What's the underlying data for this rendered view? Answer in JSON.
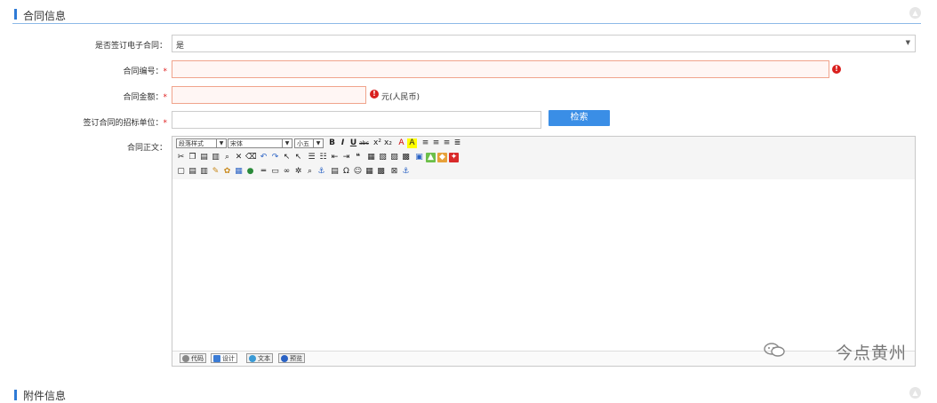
{
  "section": {
    "title": "合同信息"
  },
  "form": {
    "esign": {
      "label": "是否签订电子合同：",
      "value": "是"
    },
    "contract_no": {
      "label": "合同编号：",
      "required": "*"
    },
    "amount": {
      "label": "合同金额：",
      "required": "*",
      "unit": "元(人民币)"
    },
    "bid_unit": {
      "label": "签订合同的招标单位：",
      "required": "*",
      "search_label": "检索"
    },
    "body": {
      "label": "合同正文："
    }
  },
  "editor": {
    "style_select": "段落样式",
    "font_select": "宋体",
    "size_select": "小五",
    "row1_icons": [
      {
        "name": "bold-icon",
        "glyph": "B"
      },
      {
        "name": "italic-icon",
        "glyph": "I"
      },
      {
        "name": "underline-icon",
        "glyph": "U"
      },
      {
        "name": "strikethrough-icon",
        "glyph": "abc"
      },
      {
        "name": "superscript-icon",
        "glyph": "x²"
      },
      {
        "name": "subscript-icon",
        "glyph": "x₂"
      },
      {
        "name": "font-color-icon",
        "glyph": "A"
      },
      {
        "name": "highlight-color-icon",
        "glyph": "A"
      },
      {
        "name": "align-left-icon",
        "glyph": "≡"
      },
      {
        "name": "align-center-icon",
        "glyph": "≡"
      },
      {
        "name": "align-right-icon",
        "glyph": "≡"
      },
      {
        "name": "align-justify-icon",
        "glyph": "≣"
      }
    ],
    "modes": {
      "code": "代码",
      "design": "设计",
      "text": "文本",
      "preview": "预览"
    }
  },
  "watermark": "今点黄州",
  "section2": {
    "title": "附件信息"
  },
  "colors": {
    "accent": "#2e7bd6",
    "error": "#d9201e",
    "button": "#3a8ee6"
  }
}
